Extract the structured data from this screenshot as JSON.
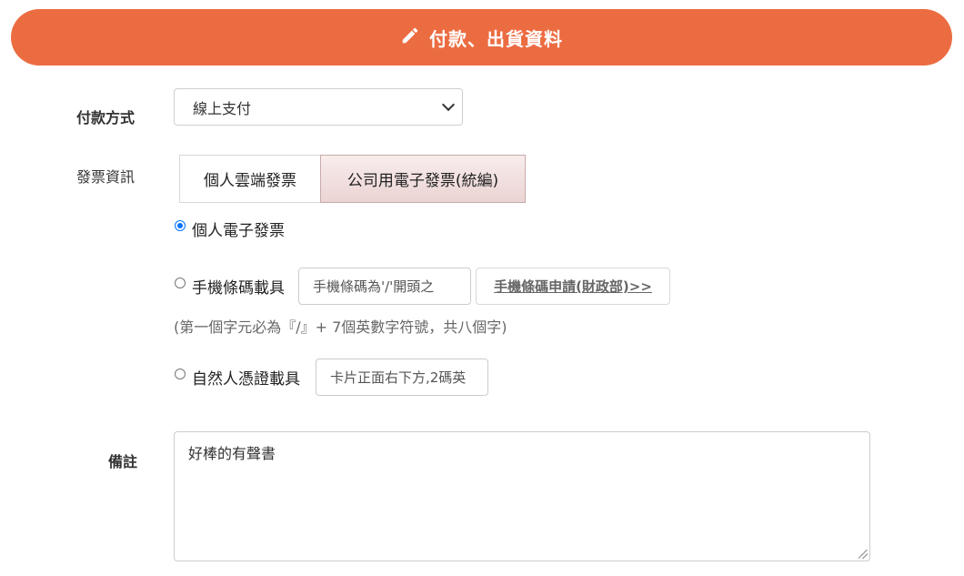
{
  "header": {
    "title": "付款、出貨資料",
    "icon": "pencil-icon",
    "color": "#ec6c42"
  },
  "payment": {
    "label": "付款方式",
    "selected": "線上支付"
  },
  "invoice": {
    "label": "發票資訊",
    "tabs": [
      {
        "label": "個人雲端發票",
        "active": false
      },
      {
        "label": "公司用電子發票(統編)",
        "active": true
      }
    ],
    "options": {
      "personal": {
        "label": "個人電子發票",
        "checked": true
      },
      "mobile": {
        "label": "手機條碼載具",
        "placeholder": "手機條碼為'/'開頭之",
        "apply_link": "手機條碼申請(財政部)>>",
        "hint": "(第一個字元必為『/』+ 7個英數字符號，共八個字)"
      },
      "citizen": {
        "label": "自然人憑證載具",
        "placeholder": "卡片正面右下方,2碼英"
      }
    }
  },
  "remark": {
    "label": "備註",
    "value": "好棒的有聲書"
  }
}
